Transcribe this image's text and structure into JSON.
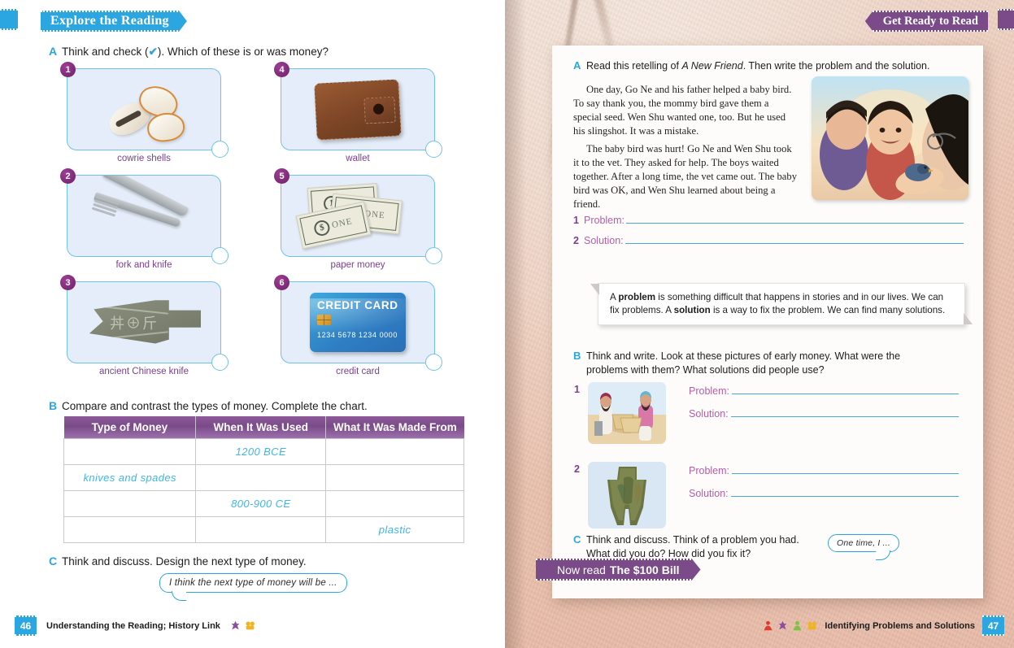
{
  "left_page": {
    "banner": "Explore the Reading",
    "question_a": {
      "letter": "A",
      "text_before": "Think and check (",
      "check_symbol": "✔",
      "text_after": "). Which of these is or was money?"
    },
    "cards": [
      {
        "number": "1",
        "label": "cowrie shells",
        "art": "cowrie-shells"
      },
      {
        "number": "4",
        "label": "wallet",
        "art": "wallet"
      },
      {
        "number": "2",
        "label": "fork and knife",
        "art": "fork-and-knife"
      },
      {
        "number": "5",
        "label": "paper money",
        "art": "paper-money"
      },
      {
        "number": "3",
        "label": "ancient Chinese knife",
        "art": "ancient-chinese-knife"
      },
      {
        "number": "6",
        "label": "credit card",
        "art": "credit-card"
      }
    ],
    "credit_card_art": {
      "title": "CREDIT CARD",
      "number": "1234 5678 1234 0000"
    },
    "bill_art": {
      "seal": "$",
      "word": "ONE",
      "corner": "1"
    },
    "question_b": {
      "letter": "B",
      "text": "Compare and contrast the types of money. Complete the chart."
    },
    "table": {
      "headers": [
        "Type of Money",
        "When It Was Used",
        "What It Was Made From"
      ],
      "rows": [
        [
          "",
          "1200 BCE",
          ""
        ],
        [
          "knives and spades",
          "",
          ""
        ],
        [
          "",
          "800-900 CE",
          ""
        ],
        [
          "",
          "",
          "plastic"
        ]
      ]
    },
    "question_c": {
      "letter": "C",
      "text": "Think and discuss. Design the next type of money."
    },
    "bubble": "I think the next type of money will be ...",
    "footer": {
      "page_number": "46",
      "text": "Understanding the Reading; History Link",
      "icons": [
        "purple-star-icon",
        "orange-pair-icon"
      ]
    }
  },
  "right_page": {
    "banner": "Get Ready to Read",
    "question_a": {
      "letter": "A",
      "text_1": "Read this retelling of ",
      "title_italic": "A New Friend",
      "text_2": ". Then write the problem and the solution."
    },
    "passage": [
      "One day, Go Ne and his father helped a baby bird. To say thank you, the mommy bird gave them a special seed. Wen Shu wanted one, too. But he used his slingshot. It was a mistake.",
      "The baby bird was hurt! Go Ne and Wen Shu took it to the vet. They asked for help. The boys waited together. After a long time, the vet came out. The baby bird was OK, and Wen Shu learned about being a friend."
    ],
    "answer_lines_a": [
      {
        "number": "1",
        "label": "Problem:"
      },
      {
        "number": "2",
        "label": "Solution:"
      }
    ],
    "definition_box": {
      "part1": "A ",
      "bold1": "problem",
      "part2": " is something difficult that happens in stories and in our lives. We can fix problems. A ",
      "bold2": "solution",
      "part3": " is a way to fix the problem. We can find many solutions."
    },
    "question_b": {
      "letter": "B",
      "text": "Think and write. Look at these pictures of early money. What were the problems with them? What solutions did people use?"
    },
    "items_b": [
      {
        "number": "1",
        "image": "traders-with-grain",
        "problem_label": "Problem:",
        "solution_label": "Solution:"
      },
      {
        "number": "2",
        "image": "bronze-spade-money",
        "problem_label": "Problem:",
        "solution_label": "Solution:"
      }
    ],
    "question_c": {
      "letter": "C",
      "text": "Think and discuss. Think of a problem you had. What did you do? How did you fix it?"
    },
    "bubble": "One time, I ...",
    "now_read": {
      "prefix": "Now read ",
      "title": "The $100 Bill"
    },
    "footer": {
      "page_number": "47",
      "text": "Identifying Problems and Solutions",
      "icons": [
        "red-person-icon",
        "purple-star-icon",
        "green-person-icon",
        "orange-pair-icon"
      ]
    }
  }
}
